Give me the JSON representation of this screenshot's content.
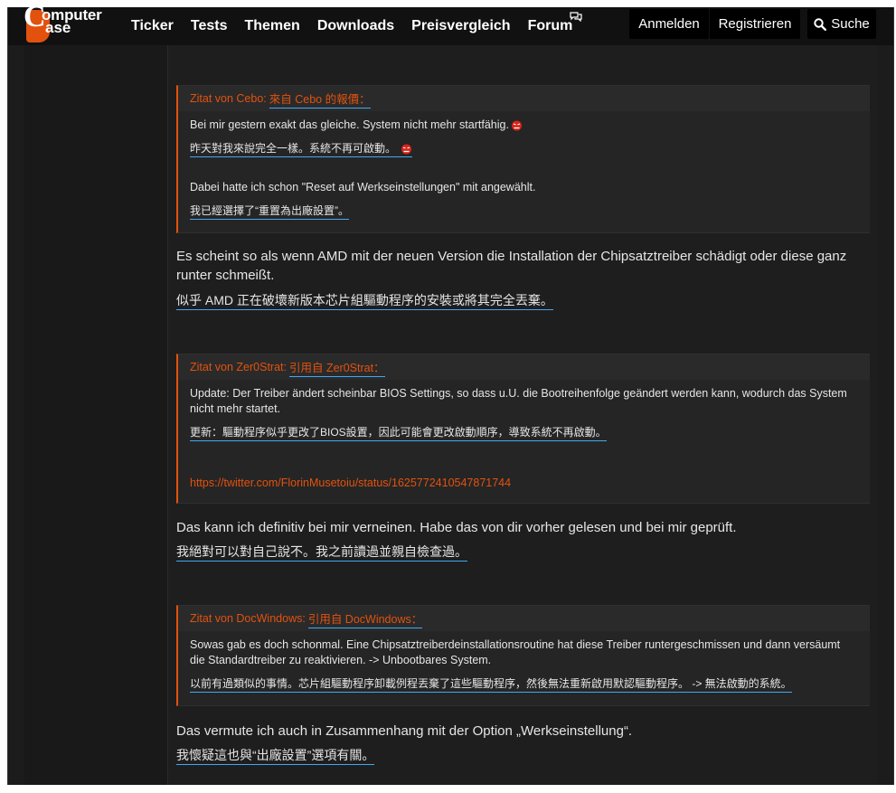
{
  "header": {
    "logo_line1": "omputer",
    "logo_line2": "ase",
    "nav": [
      "Ticker",
      "Tests",
      "Themen",
      "Downloads",
      "Preisvergleich",
      "Forum"
    ],
    "anmelden": "Anmelden",
    "registrieren": "Registrieren",
    "suche": "Suche"
  },
  "quotes": [
    {
      "label": "Zitat von Cebo:",
      "translated_label": "來自 Cebo 的報價：",
      "line1": "Bei mir gestern exakt das gleiche. System nicht mehr startfähig.",
      "line1_tr": "昨天對我來說完全一樣。系統不再可啟動。",
      "line2": "Dabei hatte ich schon \"Reset auf Werkseinstellungen\" mit angewählt.",
      "line2_tr": "我已經選擇了“重置為出廠設置”。"
    },
    {
      "label": "Zitat von Zer0Strat:",
      "translated_label": "引用自 Zer0Strat：",
      "line1a": "Update: Der Treiber ändert scheinbar BIOS Settings, so dass u.U. die Bootreihenfolge geändert werden kann, wodurch das System",
      "line1b": "nicht mehr startet.",
      "line1_tr": "更新：驅動程序似乎更改了BIOS設置，因此可能會更改啟動順序，導致系統不再啟動。",
      "link": "https://twitter.com/FlorinMusetoiu/status/1625772410547871744"
    },
    {
      "label": "Zitat von DocWindows:",
      "translated_label": "引用自 DocWindows：",
      "line1a": "Sowas gab es doch schonmal. Eine Chipsatztreiberdeinstallationsroutine hat diese Treiber runtergeschmissen und dann versäumt",
      "line1b": "die Standardtreiber zu reaktivieren. -> Unbootbares System.",
      "line1_tr": "以前有過類似的事情。芯片組驅動程序卸載例程丟棄了這些驅動程序，然後無法重新啟用默認驅動程序。 -> 無法啟動的系統。"
    }
  ],
  "posts": [
    {
      "text": "Es scheint so als wenn AMD mit der neuen Version die Installation der Chipsatztreiber schädigt oder diese ganz runter schmeißt.",
      "tr": "似乎 AMD 正在破壞新版本芯片組驅動程序的安裝或將其完全丟棄。"
    },
    {
      "text": "Das kann ich definitiv bei mir verneinen. Habe das von dir vorher gelesen und bei mir geprüft.",
      "tr": "我絕對可以對自己說不。我之前讀過並親自檢查過。"
    },
    {
      "text": "Das vermute ich auch in Zusammenhang mit der Option „Werkseinstellung“.",
      "tr": "我懷疑這也與“出廠設置”選項有關。"
    }
  ],
  "colors": {
    "accent": "#e2520e",
    "translation_underline": "#3fa9f5",
    "background": "#1c1c1c"
  }
}
